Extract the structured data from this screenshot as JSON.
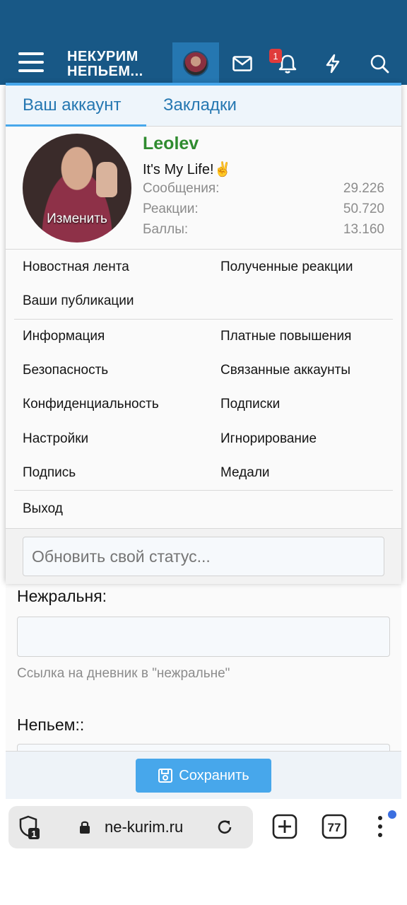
{
  "header": {
    "logo_line1": "НЕКУРИМ",
    "logo_line2": "НЕПЬЕМ...",
    "notification_count": "1",
    "accent": "#185886"
  },
  "panel": {
    "tabs": [
      {
        "label": "Ваш аккаунт",
        "active": true
      },
      {
        "label": "Закладки",
        "active": false
      }
    ],
    "profile": {
      "username": "Leolev",
      "status": "It's My Life!✌️",
      "change_label": "Изменить",
      "stats": [
        {
          "label": "Сообщения:",
          "value": "29.226"
        },
        {
          "label": "Реакции:",
          "value": "50.720"
        },
        {
          "label": "Баллы:",
          "value": "13.160"
        }
      ]
    },
    "menu_group1": {
      "left": [
        "Новостная лента",
        "Ваши публикации"
      ],
      "right": [
        "Полученные реакции"
      ]
    },
    "menu_group2": {
      "left": [
        "Информация",
        "Безопасность",
        "Конфиденциальность",
        "Настройки",
        "Подпись"
      ],
      "right": [
        "Платные повышения",
        "Связанные аккаунты",
        "Подписки",
        "Игнорирование",
        "Медали"
      ]
    },
    "logout": "Выход",
    "status_placeholder": "Обновить свой статус..."
  },
  "form": {
    "field1_label": "Нежральня:",
    "field1_hint": "Ссылка на дневник в \"нежральне\"",
    "field2_label": "Непьем::",
    "save_label": "Сохранить"
  },
  "browser": {
    "url": "ne-kurim.ru",
    "shield_count": "1",
    "tabs_count": "77"
  }
}
